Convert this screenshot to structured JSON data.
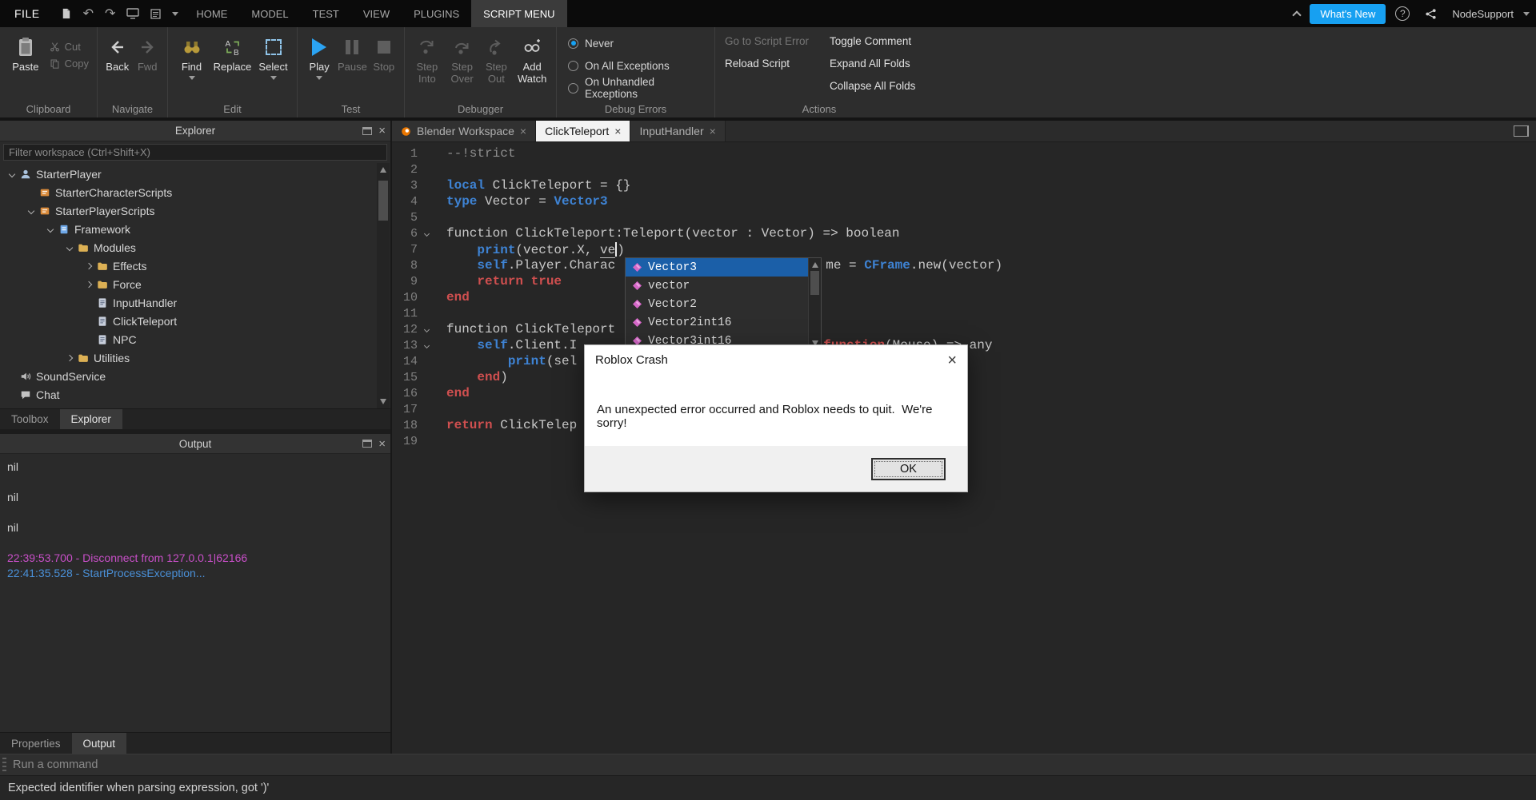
{
  "colors": {
    "accent_blue": "#17a0f1",
    "selection_blue": "#1b5fa8",
    "keyword_blue": "#3e83d4",
    "keyword_red": "#cf4f4f",
    "comment_gray": "#8f8f8f",
    "output_magenta": "#c84fc8",
    "output_info_blue": "#4a90d8",
    "play_blue": "#2ba3f2"
  },
  "menubar": {
    "file_label": "FILE",
    "tabs": [
      {
        "label": "HOME",
        "active": false
      },
      {
        "label": "MODEL",
        "active": false
      },
      {
        "label": "TEST",
        "active": false
      },
      {
        "label": "VIEW",
        "active": false
      },
      {
        "label": "PLUGINS",
        "active": false
      },
      {
        "label": "SCRIPT MENU",
        "active": true
      }
    ],
    "whats_new_label": "What's New",
    "account_label": "NodeSupport"
  },
  "ribbon": {
    "clipboard": {
      "label": "Clipboard",
      "paste": "Paste",
      "cut": "Cut",
      "copy": "Copy"
    },
    "navigate": {
      "label": "Navigate",
      "back": "Back",
      "fwd": "Fwd"
    },
    "edit": {
      "label": "Edit",
      "find": "Find",
      "replace": "Replace",
      "select": "Select"
    },
    "test": {
      "label": "Test",
      "play": "Play",
      "pause": "Pause",
      "stop": "Stop"
    },
    "debugger": {
      "label": "Debugger",
      "step_into": "Step Into",
      "step_over": "Step Over",
      "step_out": "Step Out",
      "add_watch": "Add Watch"
    },
    "debug_errors": {
      "label": "Debug Errors",
      "options": [
        {
          "label": "Never",
          "selected": true
        },
        {
          "label": "On All Exceptions",
          "selected": false
        },
        {
          "label": "On Unhandled Exceptions",
          "selected": false
        }
      ]
    },
    "actions": {
      "label": "Actions",
      "col1": [
        {
          "label": "Go to Script Error",
          "enabled": false
        },
        {
          "label": "Reload Script",
          "enabled": true
        }
      ],
      "col2": [
        {
          "label": "Toggle Comment",
          "enabled": true
        },
        {
          "label": "Expand All Folds",
          "enabled": true
        },
        {
          "label": "Collapse All Folds",
          "enabled": true
        }
      ]
    }
  },
  "explorer": {
    "title": "Explorer",
    "filter_placeholder": "Filter workspace (Ctrl+Shift+X)",
    "tree": [
      {
        "label": "StarterPlayer",
        "level": 0,
        "expand": "open",
        "icon": "person-icon"
      },
      {
        "label": "StarterCharacterScripts",
        "level": 1,
        "expand": "none",
        "icon": "starter-scripts-icon"
      },
      {
        "label": "StarterPlayerScripts",
        "level": 1,
        "expand": "open",
        "icon": "starter-scripts-icon"
      },
      {
        "label": "Framework",
        "level": 2,
        "expand": "open",
        "icon": "framework-icon"
      },
      {
        "label": "Modules",
        "level": 3,
        "expand": "open",
        "icon": "folder-icon"
      },
      {
        "label": "Effects",
        "level": 4,
        "expand": "closed",
        "icon": "folder-icon"
      },
      {
        "label": "Force",
        "level": 4,
        "expand": "closed",
        "icon": "folder-icon"
      },
      {
        "label": "InputHandler",
        "level": 4,
        "expand": "none",
        "icon": "module-script-icon"
      },
      {
        "label": "ClickTeleport",
        "level": 4,
        "expand": "none",
        "icon": "module-script-icon"
      },
      {
        "label": "NPC",
        "level": 4,
        "expand": "none",
        "icon": "module-script-icon"
      },
      {
        "label": "Utilities",
        "level": 3,
        "expand": "closed",
        "icon": "folder-icon"
      },
      {
        "label": "SoundService",
        "level": 0,
        "expand": "none",
        "icon": "sound-icon"
      },
      {
        "label": "Chat",
        "level": 0,
        "expand": "none",
        "icon": "chat-icon"
      }
    ],
    "tabs": [
      {
        "label": "Toolbox",
        "active": false
      },
      {
        "label": "Explorer",
        "active": true
      }
    ]
  },
  "output": {
    "title": "Output",
    "lines": [
      {
        "text": "nil",
        "color": "default"
      },
      {
        "text": "",
        "color": "default"
      },
      {
        "text": "nil",
        "color": "default"
      },
      {
        "text": "",
        "color": "default"
      },
      {
        "text": "nil",
        "color": "default"
      },
      {
        "text": "",
        "color": "default"
      },
      {
        "text": "22:39:53.700 - Disconnect from 127.0.0.1|62166",
        "color": "magenta"
      },
      {
        "text": "22:41:35.528 - StartProcessException...",
        "color": "blue"
      }
    ],
    "tabs": [
      {
        "label": "Properties",
        "active": false
      },
      {
        "label": "Output",
        "active": true
      }
    ]
  },
  "editor": {
    "tabs": [
      {
        "label": "Blender Workspace",
        "active": false,
        "icon": "blender-icon"
      },
      {
        "label": "ClickTeleport",
        "active": true
      },
      {
        "label": "InputHandler",
        "active": false
      }
    ],
    "lines": [
      {
        "n": 1,
        "seg": [
          {
            "t": "--!strict",
            "c": "cm"
          }
        ]
      },
      {
        "n": 2,
        "seg": []
      },
      {
        "n": 3,
        "seg": [
          {
            "t": "local",
            "c": "b"
          },
          {
            "t": " ClickTeleport = {}",
            "c": "p"
          }
        ]
      },
      {
        "n": 4,
        "seg": [
          {
            "t": "type",
            "c": "b"
          },
          {
            "t": " Vector = ",
            "c": "p"
          },
          {
            "t": "Vector3",
            "c": "b"
          }
        ]
      },
      {
        "n": 5,
        "seg": []
      },
      {
        "n": 6,
        "fold": true,
        "seg": [
          {
            "t": "function ClickTeleport:Teleport(vector : Vector) => boolean",
            "c": "p"
          }
        ]
      },
      {
        "n": 7,
        "seg": [
          {
            "t": "    ",
            "c": "p"
          },
          {
            "t": "print",
            "c": "b"
          },
          {
            "t": "(vector.X, ",
            "c": "p"
          },
          {
            "t": "ve",
            "c": "u"
          },
          {
            "caret": true
          },
          {
            "t": ")",
            "c": "p"
          }
        ]
      },
      {
        "n": 8,
        "seg": [
          {
            "t": "    ",
            "c": "p"
          },
          {
            "t": "self",
            "c": "b"
          },
          {
            "t": ".Player.Charac",
            "c": "p"
          },
          {
            "gap": 263
          },
          {
            "t": "me = ",
            "c": "p"
          },
          {
            "t": "CFrame",
            "c": "b"
          },
          {
            "t": ".new(vector)",
            "c": "p"
          }
        ]
      },
      {
        "n": 9,
        "seg": [
          {
            "t": "    ",
            "c": "p"
          },
          {
            "t": "return",
            "c": "r"
          },
          {
            "t": " ",
            "c": "p"
          },
          {
            "t": "true",
            "c": "r"
          }
        ]
      },
      {
        "n": 10,
        "seg": [
          {
            "t": "end",
            "c": "r"
          }
        ]
      },
      {
        "n": 11,
        "seg": []
      },
      {
        "n": 12,
        "fold": true,
        "seg": [
          {
            "t": "function ClickTeleport",
            "c": "p"
          }
        ]
      },
      {
        "n": 13,
        "fold": true,
        "seg": [
          {
            "t": "    ",
            "c": "p"
          },
          {
            "t": "self",
            "c": "b"
          },
          {
            "t": ".Client.I",
            "c": "p"
          },
          {
            "gap": 308
          },
          {
            "t": "function",
            "c": "r"
          },
          {
            "t": "(Mouse) => any",
            "c": "p"
          }
        ]
      },
      {
        "n": 14,
        "seg": [
          {
            "t": "        ",
            "c": "p"
          },
          {
            "t": "print",
            "c": "b"
          },
          {
            "t": "(sel",
            "c": "p"
          }
        ]
      },
      {
        "n": 15,
        "seg": [
          {
            "t": "    ",
            "c": "p"
          },
          {
            "t": "end",
            "c": "r"
          },
          {
            "t": ")",
            "c": "p"
          }
        ]
      },
      {
        "n": 16,
        "seg": [
          {
            "t": "end",
            "c": "r"
          }
        ]
      },
      {
        "n": 17,
        "seg": []
      },
      {
        "n": 18,
        "seg": [
          {
            "t": "return",
            "c": "r"
          },
          {
            "t": " ClickTelep",
            "c": "p"
          }
        ]
      },
      {
        "n": 19,
        "seg": []
      }
    ]
  },
  "autocomplete": {
    "items": [
      {
        "label": "Vector3",
        "selected": true
      },
      {
        "label": "vector",
        "selected": false
      },
      {
        "label": "Vector2",
        "selected": false
      },
      {
        "label": "Vector2int16",
        "selected": false
      },
      {
        "label": "Vector3int16",
        "selected": false
      }
    ]
  },
  "crash_dialog": {
    "title": "Roblox Crash",
    "message": "An unexpected error occurred and Roblox needs to quit.  We're sorry!",
    "ok_label": "OK"
  },
  "command_bar": {
    "placeholder": "Run a command"
  },
  "status_bar": {
    "message": "Expected identifier when parsing expression, got ')'"
  }
}
